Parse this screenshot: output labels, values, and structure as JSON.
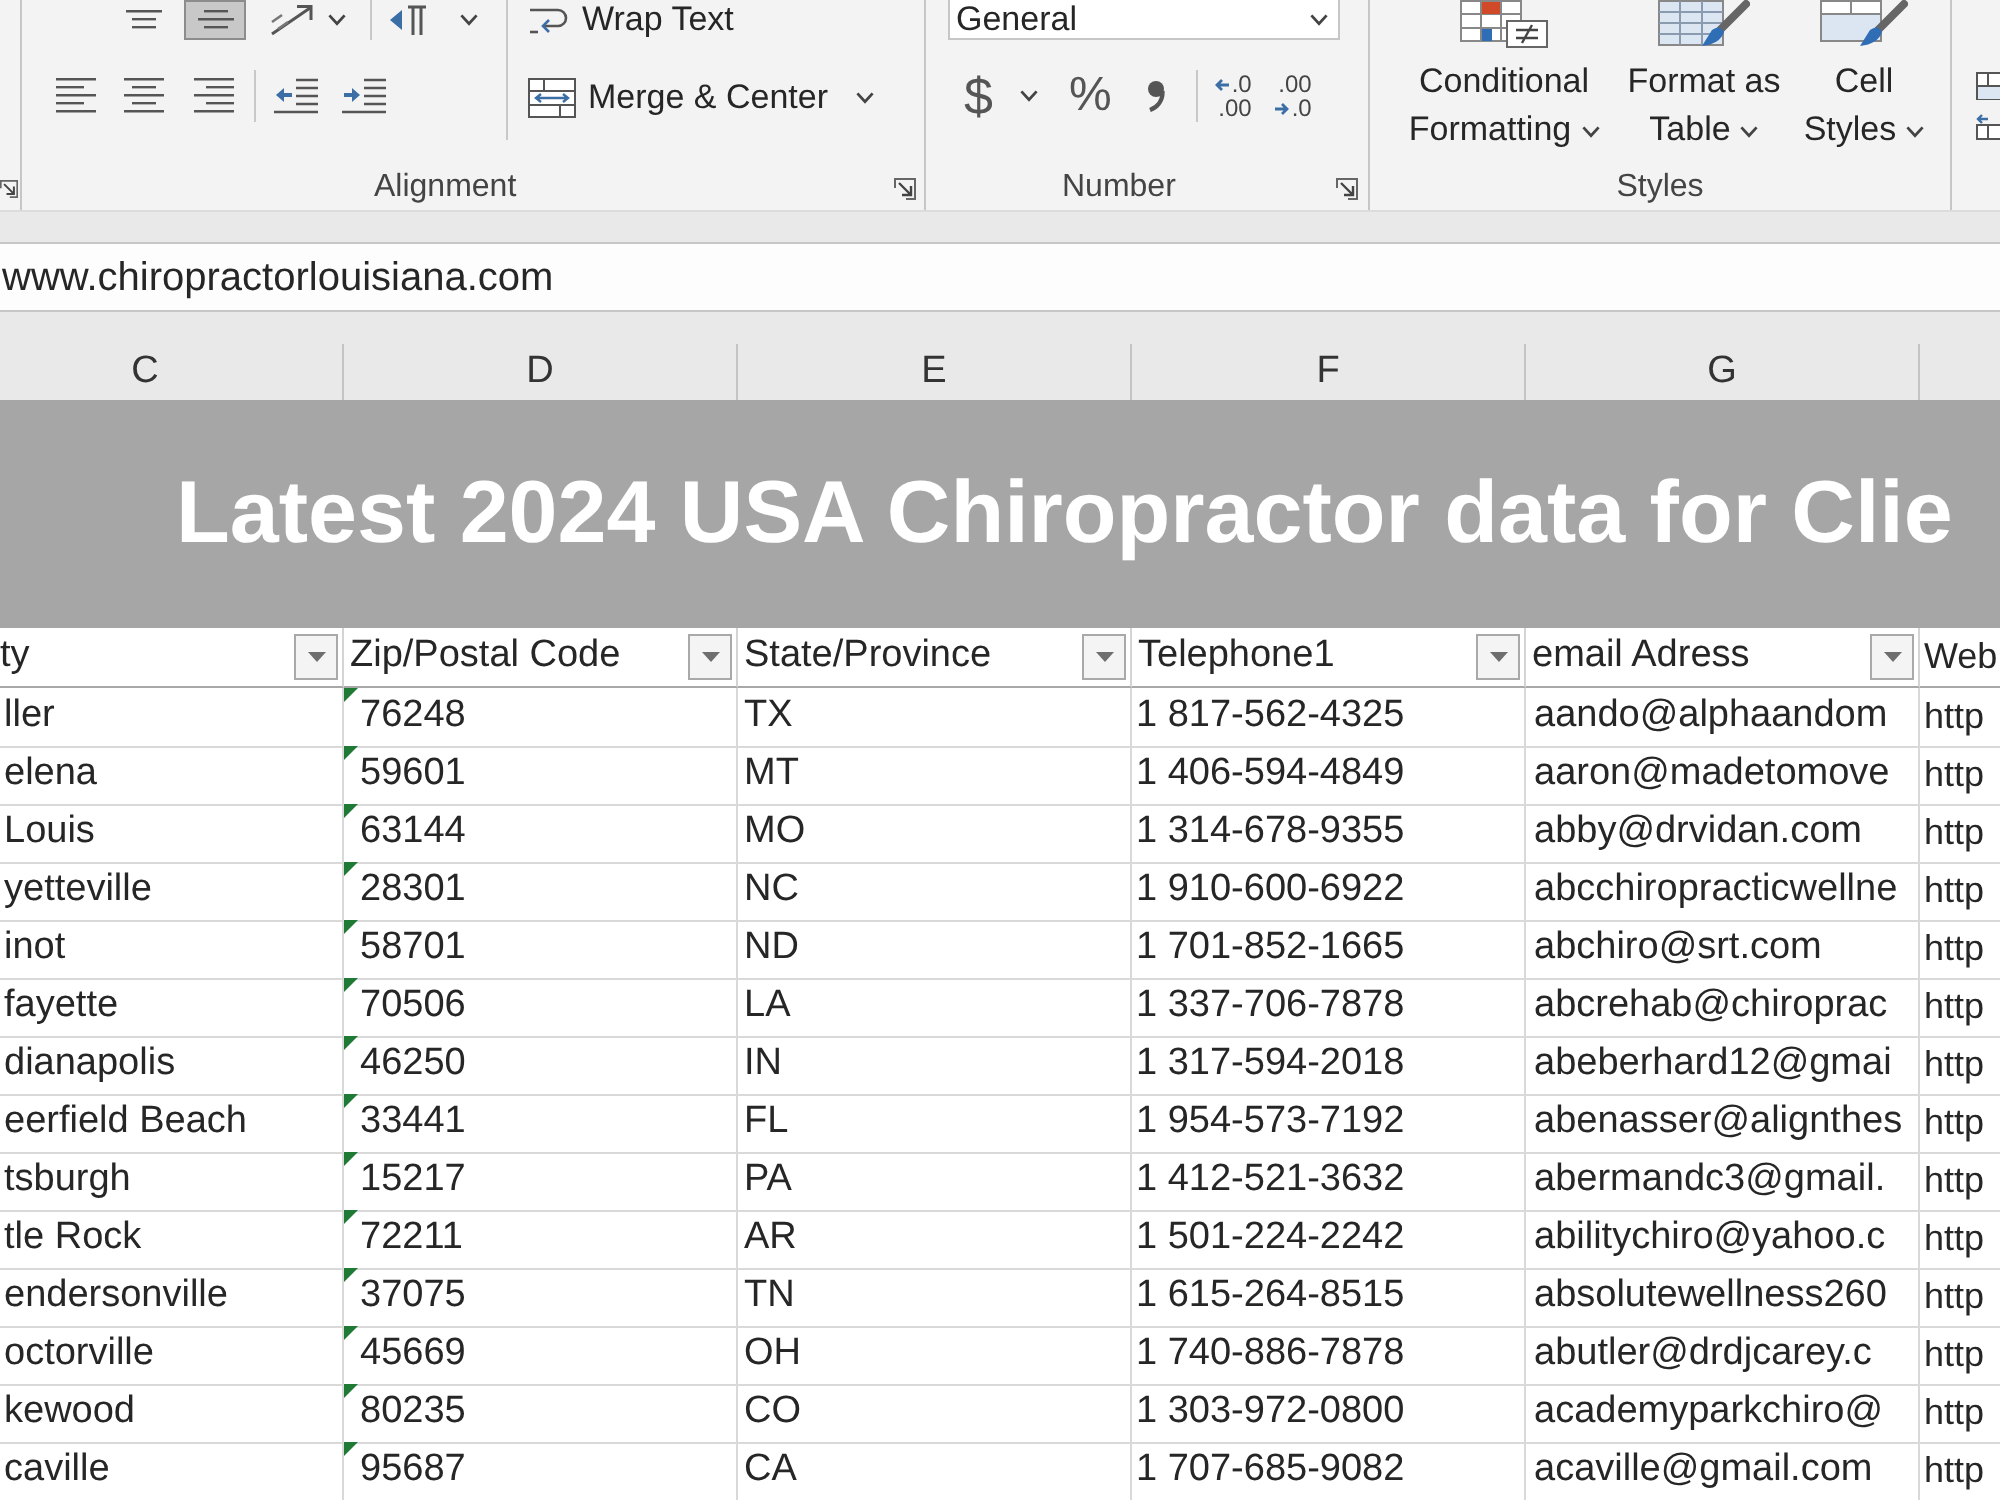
{
  "ribbon": {
    "alignment": {
      "label": "Alignment",
      "vertical_align": [
        {
          "selected": false
        },
        {
          "selected": true
        }
      ],
      "wrap_text": "Wrap Text",
      "merge_center": "Merge & Center"
    },
    "number": {
      "label": "Number",
      "format": "General",
      "currency": "$",
      "percent": "%",
      "increase_decimal": [
        ".0",
        ".00"
      ],
      "decrease_decimal": [
        ".00",
        ".0"
      ]
    },
    "styles": {
      "label": "Styles",
      "buttons": [
        "Conditional Formatting",
        "Format as Table",
        "Cell Styles"
      ]
    }
  },
  "formula_bar": {
    "value": "www.chiropractorlouisiana.com"
  },
  "sheet": {
    "columns": [
      {
        "letter": "C",
        "header": "ty",
        "kind": "text",
        "filter_button": true
      },
      {
        "letter": "D",
        "header": "Zip/Postal Code",
        "kind": "number_text",
        "filter_button": true
      },
      {
        "letter": "E",
        "header": "State/Province",
        "kind": "text",
        "filter_button": true
      },
      {
        "letter": "F",
        "header": "Telephone1",
        "kind": "text",
        "filter_button": true
      },
      {
        "letter": "G",
        "header": "email Adress",
        "kind": "text",
        "filter_button": true
      },
      {
        "header": "Web",
        "kind": "text",
        "filter_button": false
      }
    ],
    "title": "Latest 2024 USA Chiropractor data for Clie",
    "rows": [
      {
        "cells": [
          "ller",
          "76248",
          "TX",
          "1 817-562-4325",
          "aando@alphaandom",
          "http"
        ],
        "flagged": true
      },
      {
        "cells": [
          "elena",
          "59601",
          "MT",
          "1 406-594-4849",
          "aaron@madetomove",
          "http"
        ],
        "flagged": true
      },
      {
        "cells": [
          "Louis",
          "63144",
          "MO",
          "1 314-678-9355",
          "abby@drvidan.com",
          "http"
        ],
        "flagged": true
      },
      {
        "cells": [
          "yetteville",
          "28301",
          "NC",
          "1 910-600-6922",
          "abcchiropracticwellne",
          "http"
        ],
        "flagged": true
      },
      {
        "cells": [
          "inot",
          "58701",
          "ND",
          "1 701-852-1665",
          "abchiro@srt.com",
          "http"
        ],
        "flagged": true
      },
      {
        "cells": [
          "fayette",
          "70506",
          "LA",
          "1 337-706-7878",
          "abcrehab@chiroprac",
          "http"
        ],
        "flagged": true
      },
      {
        "cells": [
          "dianapolis",
          "46250",
          "IN",
          "1 317-594-2018",
          "abeberhard12@gmai",
          "http"
        ],
        "flagged": true
      },
      {
        "cells": [
          "eerfield Beach",
          "33441",
          "FL",
          "1 954-573-7192",
          "abenasser@alignthes",
          "http"
        ],
        "flagged": true
      },
      {
        "cells": [
          "tsburgh",
          "15217",
          "PA",
          "1 412-521-3632",
          "abermandc3@gmail.",
          "http"
        ],
        "flagged": true
      },
      {
        "cells": [
          "tle Rock",
          "72211",
          "AR",
          "1 501-224-2242",
          "abilitychiro@yahoo.c",
          "http"
        ],
        "flagged": true
      },
      {
        "cells": [
          "endersonville",
          "37075",
          "TN",
          "1 615-264-8515",
          "absolutewellness260",
          "http"
        ],
        "flagged": true
      },
      {
        "cells": [
          "octorville",
          "45669",
          "OH",
          "1 740-886-7878",
          "abutler@drdjcarey.c",
          "http"
        ],
        "flagged": true
      },
      {
        "cells": [
          "kewood",
          "80235",
          "CO",
          "1 303-972-0800",
          "academyparkchiro@",
          "http"
        ],
        "flagged": true
      },
      {
        "cells": [
          "caville",
          "95687",
          "CA",
          "1 707-685-9082",
          "acaville@gmail.com",
          "http"
        ],
        "flagged": true
      }
    ]
  }
}
